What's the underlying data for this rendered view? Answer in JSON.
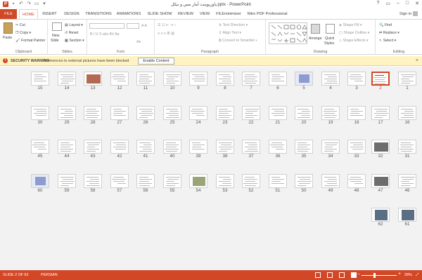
{
  "titlebar": {
    "title": "پاورپوینت آمار مس و نیکل.pptx - PowerPoint",
    "app_icon": "P",
    "window_buttons": [
      "?",
      "▭",
      "–",
      "□",
      "✕"
    ]
  },
  "tabs": [
    "FILE",
    "HOME",
    "INSERT",
    "DESIGN",
    "TRANSITIONS",
    "ANIMATIONS",
    "SLIDE SHOW",
    "REVIEW",
    "VIEW",
    "FILEminimizer",
    "Nitro PDF Professional"
  ],
  "active_tab": "HOME",
  "sign_in": "Sign in",
  "ribbon": {
    "clipboard": {
      "paste": "Paste",
      "cut": "Cut",
      "copy": "Copy",
      "format_painter": "Format Painter",
      "label": "Clipboard"
    },
    "slides": {
      "new_slide": "New",
      "new_slide_2": "Slide",
      "layout": "Layout",
      "reset": "Reset",
      "section": "Section",
      "label": "Slides"
    },
    "font": {
      "label": "Font"
    },
    "paragraph": {
      "text_direction": "Text Direction",
      "align_text": "Align Text",
      "convert_smartart": "Convert to SmartArt",
      "label": "Paragraph"
    },
    "drawing": {
      "arrange": "Arrange",
      "quick_styles": "Quick",
      "quick_styles_2": "Styles",
      "shape_fill": "Shape Fill",
      "shape_outline": "Shape Outline",
      "shape_effects": "Shape Effects",
      "label": "Drawing"
    },
    "editing": {
      "find": "Find",
      "replace": "Replace",
      "select": "Select",
      "label": "Editing"
    }
  },
  "security_bar": {
    "heading": "SECURITY WARNING",
    "message": "References to external pictures have been blocked",
    "button": "Enable Content"
  },
  "slides": [
    {
      "n": "15",
      "t": "text"
    },
    {
      "n": "14",
      "t": "text"
    },
    {
      "n": "13",
      "t": "photo"
    },
    {
      "n": "12",
      "t": "text"
    },
    {
      "n": "11",
      "t": "text"
    },
    {
      "n": "10",
      "t": "text"
    },
    {
      "n": "9",
      "t": "text"
    },
    {
      "n": "8",
      "t": "text"
    },
    {
      "n": "7",
      "t": "text"
    },
    {
      "n": "6",
      "t": "text"
    },
    {
      "n": "5",
      "t": "blue"
    },
    {
      "n": "4",
      "t": "text"
    },
    {
      "n": "3",
      "t": "text"
    },
    {
      "n": "2",
      "t": "sel"
    },
    {
      "n": "1",
      "t": "text"
    },
    {
      "n": "30",
      "t": "text"
    },
    {
      "n": "29",
      "t": "text"
    },
    {
      "n": "28",
      "t": "text"
    },
    {
      "n": "27",
      "t": "text"
    },
    {
      "n": "26",
      "t": "text"
    },
    {
      "n": "25",
      "t": "text"
    },
    {
      "n": "24",
      "t": "text"
    },
    {
      "n": "23",
      "t": "text"
    },
    {
      "n": "22",
      "t": "text"
    },
    {
      "n": "21",
      "t": "text"
    },
    {
      "n": "20",
      "t": "text"
    },
    {
      "n": "19",
      "t": "text"
    },
    {
      "n": "18",
      "t": "text"
    },
    {
      "n": "17",
      "t": "text"
    },
    {
      "n": "16",
      "t": "text"
    },
    {
      "n": "45",
      "t": "text"
    },
    {
      "n": "44",
      "t": "text"
    },
    {
      "n": "43",
      "t": "text"
    },
    {
      "n": "42",
      "t": "text"
    },
    {
      "n": "41",
      "t": "text"
    },
    {
      "n": "40",
      "t": "text"
    },
    {
      "n": "39",
      "t": "text"
    },
    {
      "n": "38",
      "t": "text"
    },
    {
      "n": "37",
      "t": "text"
    },
    {
      "n": "36",
      "t": "text"
    },
    {
      "n": "35",
      "t": "text"
    },
    {
      "n": "34",
      "t": "text"
    },
    {
      "n": "33",
      "t": "text"
    },
    {
      "n": "32",
      "t": "dark"
    },
    {
      "n": "31",
      "t": "text"
    },
    {
      "n": "60",
      "t": "blue"
    },
    {
      "n": "59",
      "t": "text"
    },
    {
      "n": "58",
      "t": "text"
    },
    {
      "n": "57",
      "t": "text"
    },
    {
      "n": "56",
      "t": "text"
    },
    {
      "n": "55",
      "t": "text"
    },
    {
      "n": "54",
      "t": "green"
    },
    {
      "n": "53",
      "t": "text"
    },
    {
      "n": "52",
      "t": "text"
    },
    {
      "n": "51",
      "t": "text"
    },
    {
      "n": "50",
      "t": "text"
    },
    {
      "n": "49",
      "t": "text"
    },
    {
      "n": "48",
      "t": "text"
    },
    {
      "n": "47",
      "t": "dark"
    },
    {
      "n": "46",
      "t": "text"
    },
    {
      "n": "62",
      "t": "photo2"
    },
    {
      "n": "61",
      "t": "photo2"
    }
  ],
  "selected_slide": "2",
  "statusbar": {
    "slide_info": "SLIDE 2 OF 62",
    "language": "PERSIAN",
    "zoom": "28%"
  },
  "colors": {
    "accent": "#d24726",
    "warning_bg": "#fff4c1",
    "sorter_bg": "#f2f2f2"
  }
}
